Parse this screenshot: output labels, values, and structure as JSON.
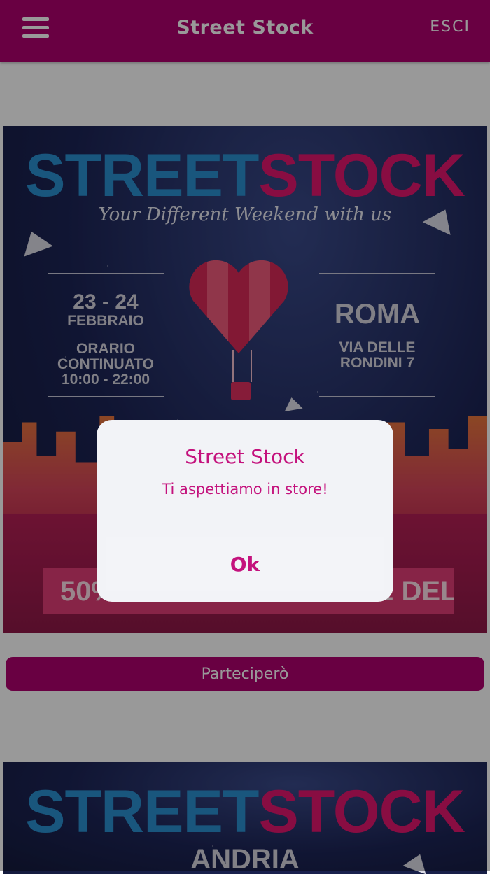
{
  "header": {
    "title": "Street Stock",
    "logout_label": "ESCI"
  },
  "events": [
    {
      "logo_part1": "STREET",
      "logo_part2": "STOCK",
      "tagline": "Your Different Weekend with us",
      "dates": "23 - 24",
      "month": "FEBBRAIO",
      "hours_label1": "ORARIO",
      "hours_label2": "CONTINUATO",
      "hours": "10:00 - 22:00",
      "city": "ROMA",
      "address1": "VIA DELLE",
      "address2": "RONDINI 7",
      "ribbon_text": "50% SCONTO NEL MESE DELL'AMORE",
      "participate_label": "Parteciperò"
    },
    {
      "logo_part1": "STREET",
      "logo_part2": "STOCK",
      "city": "ANDRIA"
    }
  ],
  "alert": {
    "title": "Street Stock",
    "message": "Ti aspettiamo in store!",
    "ok_label": "Ok"
  },
  "colors": {
    "brand": "#b0006f",
    "alert_text": "#c4127d"
  }
}
